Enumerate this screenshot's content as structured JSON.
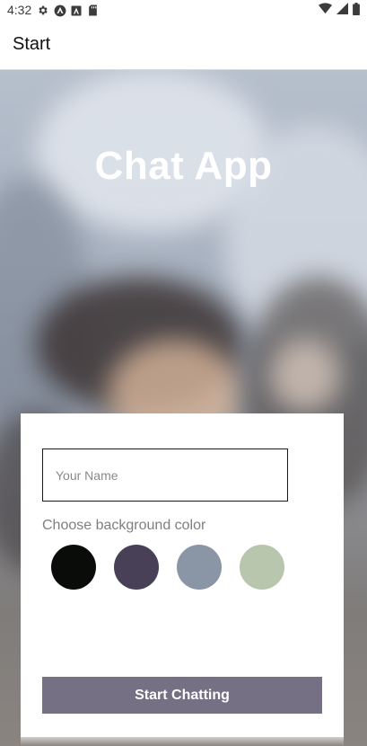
{
  "status_bar": {
    "time": "4:32",
    "left_icons": [
      "gear-icon",
      "react-native-icon",
      "autofill-icon",
      "sd-card-icon"
    ],
    "right_icons": [
      "wifi-icon",
      "cellular-signal-icon",
      "battery-icon"
    ]
  },
  "app_bar": {
    "title": "Start"
  },
  "hero": {
    "title": "Chat App"
  },
  "form": {
    "name_placeholder": "Your Name",
    "name_value": "",
    "color_label": "Choose background color",
    "colors": [
      "#090C08",
      "#474056",
      "#8A95A5",
      "#B9C6AE"
    ],
    "start_button_label": "Start Chatting",
    "start_button_color": "#757083"
  }
}
